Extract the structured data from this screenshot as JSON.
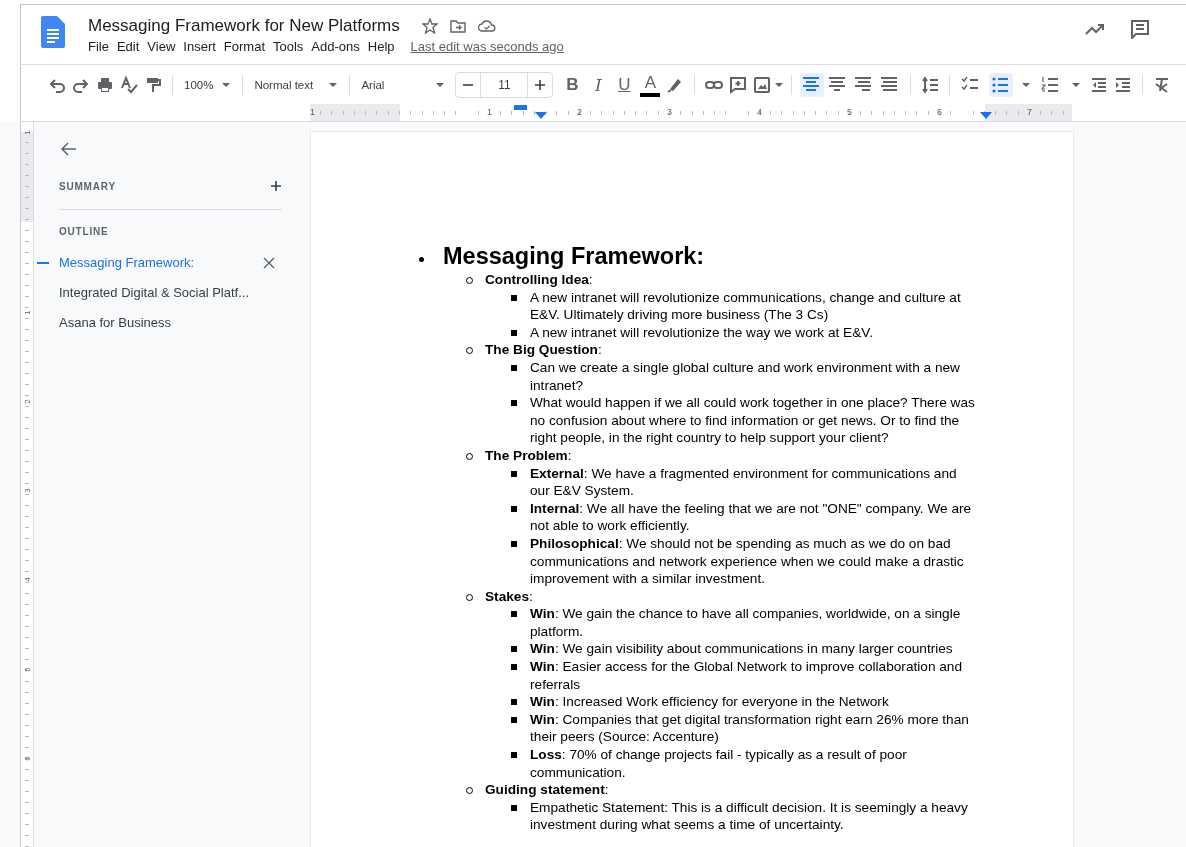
{
  "header": {
    "title": "Messaging Framework for New Platforms",
    "menu": [
      "File",
      "Edit",
      "View",
      "Insert",
      "Format",
      "Tools",
      "Add-ons",
      "Help"
    ],
    "last_edit": "Last edit was seconds ago"
  },
  "toolbar": {
    "zoom": "100%",
    "style": "Normal text",
    "font": "Arial",
    "font_size": "11",
    "format_buttons": [
      {
        "kind": "bold",
        "label": "B"
      },
      {
        "kind": "italic",
        "label": "I"
      },
      {
        "kind": "underline",
        "label": "U"
      },
      {
        "kind": "color",
        "label": "A"
      }
    ],
    "align_buttons": [
      {
        "kind": "left",
        "selected": true
      },
      {
        "kind": "center",
        "selected": false
      },
      {
        "kind": "right",
        "selected": false
      },
      {
        "kind": "justify",
        "selected": false
      }
    ],
    "list_buttons": [
      {
        "kind": "checklist",
        "selected": false
      },
      {
        "kind": "bulleted",
        "selected": true
      },
      {
        "kind": "numbered",
        "selected": false
      }
    ]
  },
  "ruler": {
    "labels": [
      "1",
      "1",
      "2",
      "3",
      "4",
      "5",
      "6",
      "7"
    ]
  },
  "vertical_ruler": {
    "labels": [
      "1",
      "1",
      "2",
      "3",
      "4",
      "5",
      "6"
    ]
  },
  "sidebar": {
    "summary_label": "SUMMARY",
    "outline_label": "OUTLINE",
    "items": [
      {
        "text": "Messaging Framework:",
        "selected": true
      },
      {
        "text": "Integrated Digital & Social Platf...",
        "selected": false
      },
      {
        "text": "Asana for Business",
        "selected": false
      }
    ]
  },
  "document": {
    "heading": "Messaging Framework:",
    "sections": [
      {
        "title": "**Controlling Idea**:",
        "bullets": [
          "A new intranet will revolutionize communications, change and culture at E&V. Ultimately driving more business (The 3 Cs)",
          "A new intranet will revolutionize the way we work at E&V."
        ]
      },
      {
        "title": "**The Big Question**:",
        "bullets": [
          "Can we create a single global culture and work environment with a new intranet?",
          "What would happen if we all could work together in one place? There was no confusion about where to find information or get news. Or to find the right people, in the right country to help support your client?"
        ]
      },
      {
        "title": "**The Problem**:",
        "bullets": [
          "**External**: We have a fragmented environment for communications and our E&V System.",
          "**Internal**: We all have the feeling that we are not \"ONE\" company. We are not able to work efficiently.",
          "**Philosophical**: We should not be spending as much as we do on bad communications and network experience when we could make a drastic improvement with a similar investment."
        ]
      },
      {
        "title": "**Stakes**:",
        "bullets": [
          "**Win**: We gain the chance to have all companies, worldwide, on a single platform.",
          "**Win**: We gain visibility about communications in many larger countries",
          "**Win**: Easier access for the Global Network to improve collaboration and referrals",
          "**Win**: Increased Work efficiency for everyone in the Network",
          "**Win**: Companies that get digital transformation right earn 26% more than their peers (Source: Accenture)",
          "**Loss**: 70% of change projects fail - typically as a result of poor communication."
        ]
      },
      {
        "title": "**Guiding statement**:",
        "bullets": [
          "Empathetic Statement: This is a difficult decision. It is seemingly a heavy investment during what seems a time of uncertainty."
        ]
      }
    ]
  }
}
